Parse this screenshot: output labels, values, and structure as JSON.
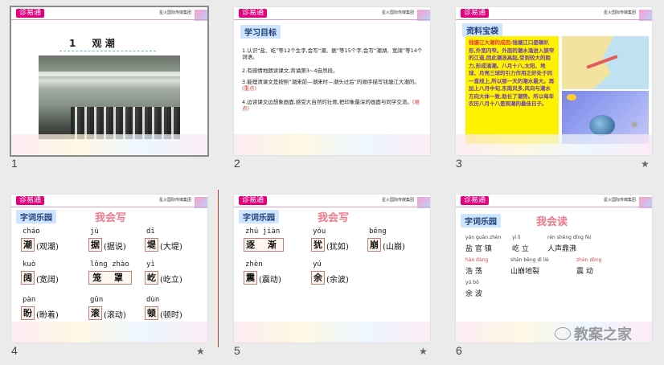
{
  "brand_logo": "诊易通",
  "publisher": "星火国际传媒集团",
  "accent": "#e4007f",
  "slides": [
    {
      "number": "1",
      "title_num": "1",
      "title": "观 潮"
    },
    {
      "number": "2",
      "tag": "学习目标",
      "objectives": [
        {
          "text": "1.认识“盐、屹”等12个生字,会写“潮、据”等15个字,会写“潮湖、宽阔”等14个词语。",
          "note": ""
        },
        {
          "text": "2.有感情地朗读课文,背诵第3~4自然段。",
          "note": ""
        },
        {
          "text": "3.能理清课文是按照“潮来前—潮来时—潮头过后”的顺序描写钱塘江大潮的。",
          "note": "(重点)"
        },
        {
          "text": "4.边读课文边想象画面,感受大自然的壮观,把印象最深的画面与同学交流。",
          "note": "(难点)"
        }
      ]
    },
    {
      "number": "3",
      "tag": "资料宝袋",
      "info_title": "钱塘江大潮的成因:",
      "info_body": "钱塘江口是喇叭形,外宽内窄。外面的潮水涌进入狭窄的江道,因此潮浪高起,受到较大的阻力,形成涌潮。八月十八,太阳、地球、月亮三球的引力作用正好处于同一直线上,所以那一天的潮水最大。再加上八月中旬,东南风多,风向与潮水方向大体一致,助长了潮势。所以每年农历八月十八是观潮的最佳日子。"
    },
    {
      "number": "4",
      "tag": "字词乐园",
      "heading": "我会写",
      "rows": [
        [
          {
            "py": "cháo",
            "ch": "潮",
            "ex": "(观潮)"
          },
          {
            "py": "jù",
            "ch": "据",
            "ex": "(据说)"
          },
          {
            "py": "dī",
            "ch": "堤",
            "ex": "(大堤)"
          }
        ],
        [
          {
            "py": "kuò",
            "ch": "阔",
            "ex": "(宽阔)"
          },
          {
            "py": "lǒng zhào",
            "ch": "笼 罩",
            "ex": ""
          },
          {
            "py": "yì",
            "ch": "屹",
            "ex": "(屹立)"
          }
        ],
        [
          {
            "py": "pàn",
            "ch": "盼",
            "ex": "(盼着)"
          },
          {
            "py": "gǔn",
            "ch": "滚",
            "ex": "(滚动)"
          },
          {
            "py": "dùn",
            "ch": "顿",
            "ex": "(顿时)"
          }
        ]
      ]
    },
    {
      "number": "5",
      "tag": "字词乐园",
      "heading": "我会写",
      "rows": [
        [
          {
            "py": "zhú jiàn",
            "ch": "逐 渐",
            "ex": ""
          },
          {
            "py": "yóu",
            "ch": "犹",
            "ex": "(犹如)"
          },
          {
            "py": "bēng",
            "ch": "崩",
            "ex": "(山崩)"
          }
        ],
        [
          {
            "py": "zhèn",
            "ch": "震",
            "ex": "(震动)"
          },
          {
            "py": "yú",
            "ch": "余",
            "ex": "(余波)"
          }
        ]
      ]
    },
    {
      "number": "6",
      "tag": "字词乐园",
      "heading": "我会读",
      "reads": [
        {
          "py": "yán guān zhèn",
          "w": "盐 官 镇"
        },
        {
          "py": "yì lì",
          "w": "屹 立"
        },
        {
          "py": "rén shēng dǐng fèi",
          "w": "人声鼎沸"
        },
        {
          "py": "hào dàng",
          "w": "浩 荡"
        },
        {
          "py": "shān bēng dì liè",
          "w": "山崩地裂"
        },
        {
          "py": "zhèn dòng",
          "w": "震 动"
        },
        {
          "py": "yú bō",
          "w": "余 波"
        }
      ]
    }
  ],
  "watermark": "教案之家",
  "colors": {
    "selected_border": "#8a8a8a",
    "heading_pink": "#f07b8c",
    "tag_blue": "#cfe4ff",
    "info_yellow": "#fff200"
  }
}
